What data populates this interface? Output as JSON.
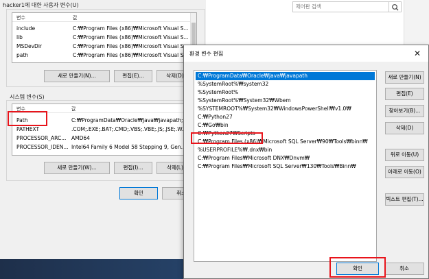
{
  "user_vars": {
    "label": "hacker1에 대한 사용자 변수(U)",
    "headers": [
      "변수",
      "값"
    ],
    "rows": [
      {
        "name": "include",
        "value": "C:₩Program Files (x86)₩Microsoft Visual S..."
      },
      {
        "name": "lib",
        "value": "C:₩Program Files (x86)₩Microsoft Visual S..."
      },
      {
        "name": "MSDevDir",
        "value": "C:₩Program Files (x86)₩Microsoft Visual S..."
      },
      {
        "name": "path",
        "value": "C:₩Program Files (x86)₩Microsoft Visual S..."
      }
    ],
    "buttons": {
      "new": "새로 만들기(N)...",
      "edit": "편집(E)...",
      "delete": "삭제(D)"
    }
  },
  "system_vars": {
    "label": "시스템 변수(S)",
    "headers": [
      "변수",
      "값"
    ],
    "rows": [
      {
        "name": "Path",
        "value": "C:₩ProgramData₩Oracle₩Java₩javapath;C:..."
      },
      {
        "name": "PATHEXT",
        "value": ".COM;.EXE;.BAT;.CMD;.VBS;.VBE;.JS;.JSE;.W..."
      },
      {
        "name": "PROCESSOR_ARC...",
        "value": "AMD64"
      },
      {
        "name": "PROCESSOR_IDEN...",
        "value": "Intel64 Family 6 Model 58 Stepping 9, Gen..."
      }
    ],
    "buttons": {
      "new": "새로 만들기(W)...",
      "edit": "편집(I)...",
      "delete": "삭제(L)"
    }
  },
  "main_buttons": {
    "ok": "확인",
    "cancel": "취소"
  },
  "control_panel": {
    "search_placeholder": "제어판 검색"
  },
  "edit_dialog": {
    "title": "환경 변수 편집",
    "close_glyph": "✕",
    "selected_index": 0,
    "entries": [
      "C:₩ProgramData₩Oracle₩Java₩javapath",
      "%SystemRoot%₩system32",
      "%SystemRoot%",
      "%SystemRoot%₩System32₩Wbem",
      "%SYSTEMROOT%₩System32₩WindowsPowerShell₩v1.0₩",
      "C:₩Python27",
      "C:₩Go₩bin",
      "C:₩Python27₩Scripts",
      "C:₩Program Files (x86)₩Microsoft SQL Server₩90₩Tools₩binn₩",
      "%USERPROFILE%₩.dnx₩bin",
      "C:₩Program Files₩Microsoft DNX₩Dnvm₩",
      "C:₩Program Files₩Microsoft SQL Server₩130₩Tools₩Binn₩"
    ],
    "buttons": {
      "new": "새로 만들기(N)",
      "edit": "편집(E)",
      "browse": "찾아보기(B)...",
      "delete": "삭제(D)",
      "move_up": "위로 이동(U)",
      "move_down": "아래로 이동(O)",
      "edit_text": "텍스트 편집(T)...",
      "ok": "확인",
      "cancel": "취소"
    }
  },
  "colors": {
    "selection": "#0078d7",
    "annotation": "#e8141b"
  }
}
